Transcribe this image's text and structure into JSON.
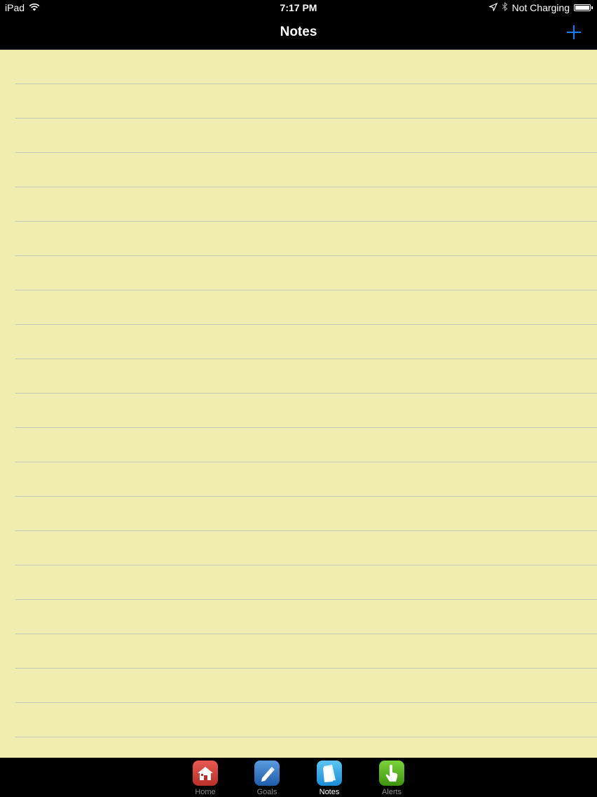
{
  "status_bar": {
    "device": "iPad",
    "time": "7:17 PM",
    "charging": "Not Charging",
    "battery_level": 1.0
  },
  "nav_bar": {
    "title": "Notes",
    "add_icon": "plus-icon",
    "accent_color": "#1a7cf5"
  },
  "notes": {
    "background_color": "#f1edb0",
    "line_color": "#c4c9b6",
    "entries": []
  },
  "tab_bar": {
    "tabs": [
      {
        "label": "Home",
        "icon": "home-icon",
        "color": "#d8403a",
        "active": false
      },
      {
        "label": "Goals",
        "icon": "pen-icon",
        "color": "#2f74c8",
        "active": false
      },
      {
        "label": "Notes",
        "icon": "notes-icon",
        "color": "#2ba3e8",
        "active": true
      },
      {
        "label": "Alerts",
        "icon": "hand-pointer-icon",
        "color": "#4cae1a",
        "active": false
      }
    ]
  }
}
